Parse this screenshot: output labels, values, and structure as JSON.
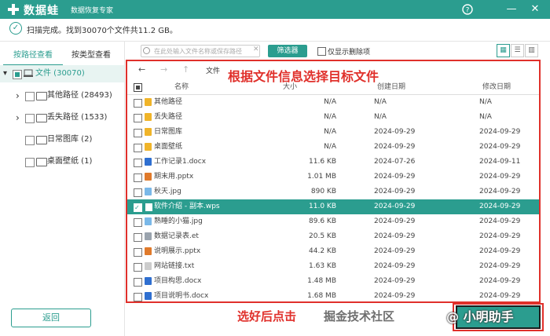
{
  "app": {
    "brand": "数据蛙",
    "subtitle": "数据恢复专家",
    "help_icon": "help-icon",
    "minimize_icon": "minimize-icon",
    "close_icon": "close-icon"
  },
  "status": {
    "text": "扫描完成。找到30070个文件共11.2 GB。"
  },
  "tabs": [
    "按路径查看",
    "按类型查看"
  ],
  "tree": [
    {
      "label": "文件 (30070)",
      "selected": true
    },
    {
      "label": "其他路径 (28493)",
      "selected": false
    },
    {
      "label": "丢失路径 (1533)",
      "selected": false
    },
    {
      "label": "日常图库 (2)",
      "selected": false
    },
    {
      "label": "桌面壁纸 (1)",
      "selected": false
    }
  ],
  "back_button": "返回",
  "toolbar": {
    "search_placeholder": "在此处输入文件名称或保存路径",
    "filter_button": "筛选器",
    "only_deleted": "仅显示删除项"
  },
  "nav": {
    "crumb": "文件"
  },
  "annotations": {
    "top": "根据文件信息选择目标文件",
    "bottom": "选好后点击",
    "watermark": "掘金技术社区",
    "watermark2": "@ 小明助手"
  },
  "columns": {
    "name": "名称",
    "size": "大小",
    "created": "创建日期",
    "modified": "修改日期"
  },
  "files": [
    {
      "name": "其他路径",
      "size": "N/A",
      "created": "N/A",
      "modified": "N/A",
      "icon": "folder-icon",
      "color": "#f0b429",
      "selected": false
    },
    {
      "name": "丢失路径",
      "size": "N/A",
      "created": "N/A",
      "modified": "N/A",
      "icon": "folder-icon",
      "color": "#f0b429",
      "selected": false
    },
    {
      "name": "日常图库",
      "size": "N/A",
      "created": "2024-09-29",
      "modified": "2024-09-29",
      "icon": "folder-icon",
      "color": "#f0b429",
      "selected": false
    },
    {
      "name": "桌面壁纸",
      "size": "N/A",
      "created": "2024-09-29",
      "modified": "2024-09-29",
      "icon": "folder-icon",
      "color": "#f0b429",
      "selected": false
    },
    {
      "name": "工作记录1.docx",
      "size": "11.6 KB",
      "created": "2024-07-26",
      "modified": "2024-09-11",
      "icon": "word-icon",
      "color": "#2f6fd0",
      "selected": false
    },
    {
      "name": "期末用.pptx",
      "size": "1.01 MB",
      "created": "2024-09-29",
      "modified": "2024-09-29",
      "icon": "ppt-icon",
      "color": "#e07a2b",
      "selected": false
    },
    {
      "name": "秋天.jpg",
      "size": "890 KB",
      "created": "2024-09-29",
      "modified": "2024-09-29",
      "icon": "image-icon",
      "color": "#7ab8e8",
      "selected": false
    },
    {
      "name": "软件介绍 - 副本.wps",
      "size": "11.0 KB",
      "created": "2024-09-29",
      "modified": "2024-09-29",
      "icon": "wps-icon",
      "color": "#ffffff",
      "selected": true
    },
    {
      "name": "熟睡的小猫.jpg",
      "size": "89.6 KB",
      "created": "2024-09-29",
      "modified": "2024-09-29",
      "icon": "image-icon",
      "color": "#7ab8e8",
      "selected": false
    },
    {
      "name": "数据记录表.et",
      "size": "20.5 KB",
      "created": "2024-09-29",
      "modified": "2024-09-29",
      "icon": "sheet-icon",
      "color": "#9aa3ad",
      "selected": false
    },
    {
      "name": "说明展示.pptx",
      "size": "44.2 KB",
      "created": "2024-09-29",
      "modified": "2024-09-29",
      "icon": "ppt-icon",
      "color": "#e07a2b",
      "selected": false
    },
    {
      "name": "网站链接.txt",
      "size": "1.63 KB",
      "created": "2024-09-29",
      "modified": "2024-09-29",
      "icon": "text-icon",
      "color": "#cccccc",
      "selected": false
    },
    {
      "name": "项目构思.docx",
      "size": "1.48 MB",
      "created": "2024-09-29",
      "modified": "2024-09-29",
      "icon": "word-icon",
      "color": "#2f6fd0",
      "selected": false
    },
    {
      "name": "项目说明书.docx",
      "size": "1.68 MB",
      "created": "2024-09-29",
      "modified": "2024-09-29",
      "icon": "word-icon",
      "color": "#2f6fd0",
      "selected": false
    }
  ]
}
